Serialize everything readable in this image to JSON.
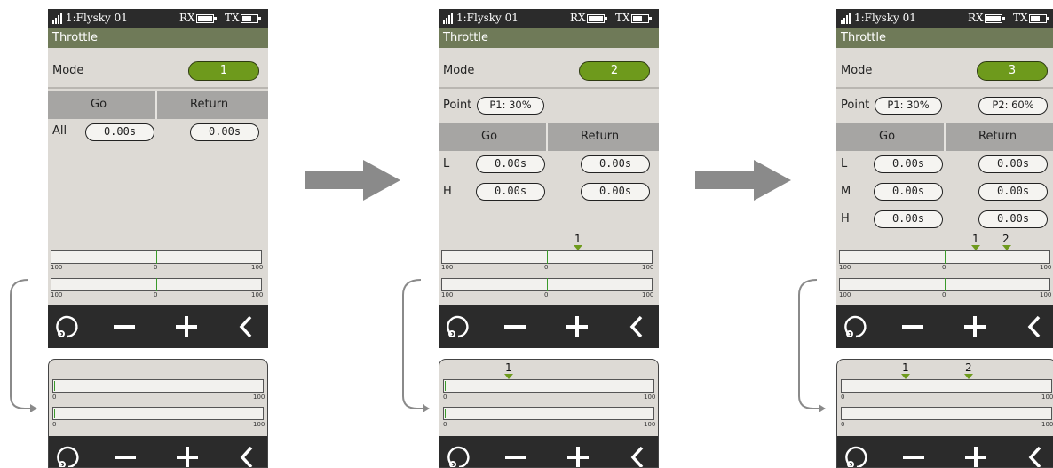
{
  "status_bar": {
    "model": "1:Flysky 01",
    "rx_label": "RX",
    "tx_label": "TX"
  },
  "screen_title": "Throttle",
  "labels": {
    "mode": "Mode",
    "point": "Point",
    "go": "Go",
    "return": "Return"
  },
  "toolbar_icons": [
    "refresh-icon",
    "minus-icon",
    "plus-icon",
    "back-icon"
  ],
  "colors": {
    "accent": "#6e9a1c",
    "title_bar": "#6f7a58",
    "toolbar": "#2b2b2b",
    "arrow": "#8a8a8a"
  },
  "panels": [
    {
      "mode": "1",
      "rows": [
        {
          "label": "All",
          "go": "0.00s",
          "return": "0.00s"
        }
      ],
      "bar_ticks": {
        "left": "100",
        "center": "0",
        "right": "100"
      },
      "marker_labels": [],
      "mini_ticks": {
        "left": "0",
        "right": "100"
      }
    },
    {
      "mode": "2",
      "points": [
        "P1: 30%"
      ],
      "rows": [
        {
          "label": "L",
          "go": "0.00s",
          "return": "0.00s"
        },
        {
          "label": "H",
          "go": "0.00s",
          "return": "0.00s"
        }
      ],
      "bar_ticks": {
        "left": "100",
        "center": "0",
        "right": "100"
      },
      "marker_labels": [
        "1"
      ],
      "mini_ticks": {
        "left": "0",
        "right": "100"
      }
    },
    {
      "mode": "3",
      "points": [
        "P1: 30%",
        "P2: 60%"
      ],
      "rows": [
        {
          "label": "L",
          "go": "0.00s",
          "return": "0.00s"
        },
        {
          "label": "M",
          "go": "0.00s",
          "return": "0.00s"
        },
        {
          "label": "H",
          "go": "0.00s",
          "return": "0.00s"
        }
      ],
      "bar_ticks": {
        "left": "100",
        "center": "0",
        "right": "100"
      },
      "marker_labels": [
        "1",
        "2"
      ],
      "mini_ticks": {
        "left": "0",
        "right": "100"
      }
    }
  ]
}
